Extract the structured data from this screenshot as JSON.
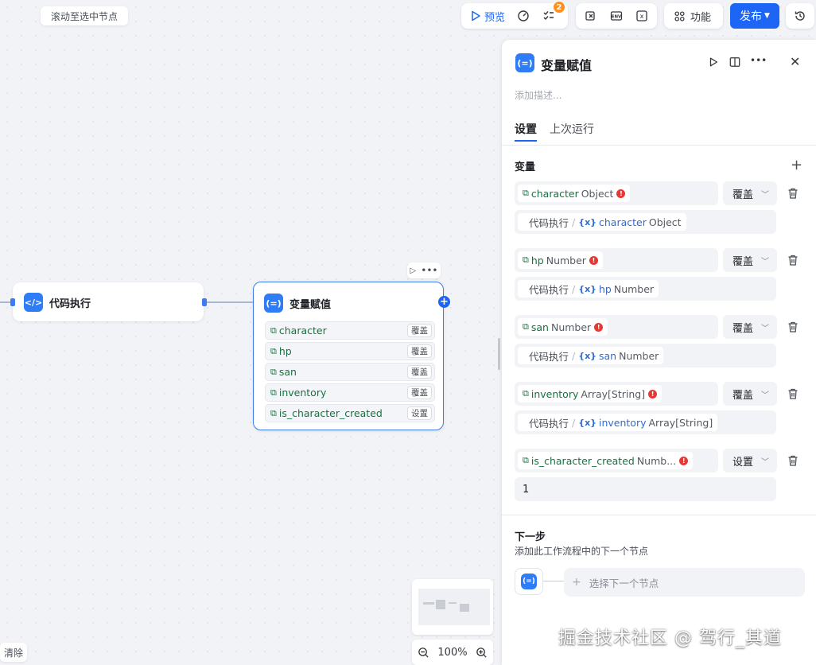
{
  "top": {
    "scroll_to_node": "滚动至选中节点",
    "preview": "预览",
    "badge_count": "2",
    "function": "功能",
    "publish": "发布"
  },
  "canvas": {
    "code_node_title": "代码执行",
    "assign_node_title": "变量赋值",
    "assign_rows": [
      {
        "name": "character",
        "mode": "覆盖"
      },
      {
        "name": "hp",
        "mode": "覆盖"
      },
      {
        "name": "san",
        "mode": "覆盖"
      },
      {
        "name": "inventory",
        "mode": "覆盖"
      },
      {
        "name": "is_character_created",
        "mode": "设置"
      }
    ],
    "clear": "清除",
    "zoom": "100%"
  },
  "panel": {
    "icon_label": "(=)",
    "title": "变量赋值",
    "desc_placeholder": "添加描述...",
    "tabs": [
      "设置",
      "上次运行"
    ],
    "section_label": "变量",
    "variables": [
      {
        "name": "character",
        "type": "Object",
        "mode": "覆盖",
        "source_node": "代码执行",
        "source_var": "character",
        "source_type": "Object"
      },
      {
        "name": "hp",
        "type": "Number",
        "mode": "覆盖",
        "source_node": "代码执行",
        "source_var": "hp",
        "source_type": "Number"
      },
      {
        "name": "san",
        "type": "Number",
        "mode": "覆盖",
        "source_node": "代码执行",
        "source_var": "san",
        "source_type": "Number"
      },
      {
        "name": "inventory",
        "type": "Array[String]",
        "mode": "覆盖",
        "source_node": "代码执行",
        "source_var": "inventory",
        "source_type": "Array[String]"
      },
      {
        "name": "is_character_created",
        "type": "Numb...",
        "mode": "设置",
        "value": "1"
      }
    ],
    "next_title": "下一步",
    "next_desc": "添加此工作流程中的下一个节点",
    "next_select": "选择下一个节点"
  },
  "watermark": "掘金技术社区 @ 驾行_其道",
  "colors": {
    "accent": "#1d65f5",
    "node_icon": "#2e7cf6",
    "var_green": "#14733e",
    "error": "#e53935",
    "badge": "#ff8f1f"
  }
}
